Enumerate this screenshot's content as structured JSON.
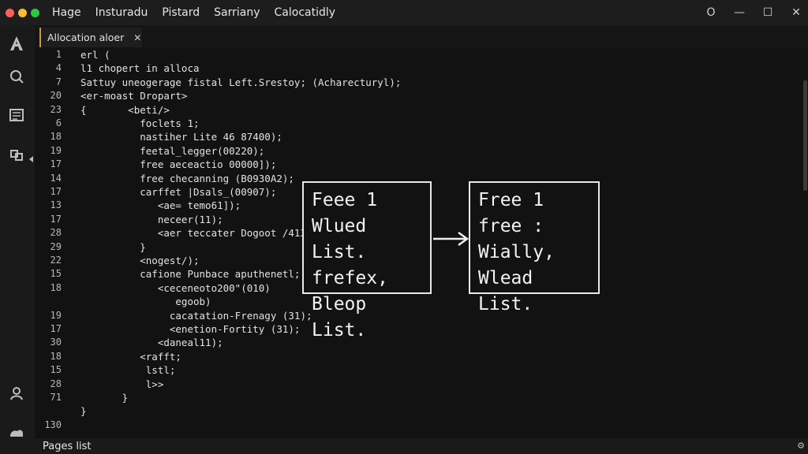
{
  "window": {
    "menu": [
      "Hage",
      "Insturadu",
      "Pistard",
      "Sarriany",
      "Calocatidly"
    ],
    "controls": [
      "O",
      "—",
      "☐",
      "✕"
    ],
    "traffic_colors": [
      "#ff5f57",
      "#febc2e",
      "#28c840"
    ]
  },
  "activity_bar": {
    "icons": [
      "explorer-icon",
      "search-icon",
      "source-control-icon",
      "extensions-icon",
      "account-icon",
      "settings-icon"
    ]
  },
  "tab": {
    "label": "Allocation aloer",
    "close": "✕"
  },
  "editor": {
    "gutter": [
      "1",
      "4",
      "7",
      "20",
      "23",
      "6",
      "18",
      "19",
      "17",
      "14",
      "17",
      "13",
      "17",
      "28",
      "29",
      "22",
      "15",
      "18",
      "19",
      "17",
      "30",
      "18",
      "15",
      "28",
      "71",
      "130"
    ],
    "lines": [
      "erl (",
      "l1 chopert in alloca",
      "Sattuy uneogerage fistal Left.Srestoy; (Acharecturyl);",
      "<er-moast Dropart>",
      "{       <beti/>",
      "          foclets 1;",
      "          nastiher Lite 46 87400);",
      "          feetal_legger(00220);",
      "          free aeceactio 00000]);",
      "          free checanning (B0930A2);",
      "          carffet |Dsals_(00907);",
      "             <ae= temo61]);",
      "             neceer(11);",
      "             <aer teccater Dogoot /41390);",
      "          }",
      "          <nogest/);",
      "          cafione Punbace aputhenetl;",
      "             <ceceneoto200\"(010)",
      "                egoob)",
      "               cacatation-Frenagy (31);",
      "               <enetion-Fortity (31);",
      "             <daneal11);",
      "          <rafft;",
      "           lstl;",
      "           l>>",
      "       }",
      "}"
    ],
    "line_numbers_for_code": [
      "1",
      "4",
      "7",
      "20",
      "23",
      "6",
      "18",
      "19",
      "17",
      "14",
      "17",
      "13",
      "17",
      "28",
      "29",
      "22",
      "15",
      "18",
      "",
      "19",
      "17",
      "30",
      "18",
      "15",
      "28",
      "71"
    ]
  },
  "diagram": {
    "left_box": [
      "Feee 1",
      "Wlued List.",
      "frefex,",
      "Bleop List."
    ],
    "right_box": [
      "Free 1",
      "free :",
      "Wially,",
      "Wlead List."
    ]
  },
  "status": {
    "label": "Pages list"
  }
}
